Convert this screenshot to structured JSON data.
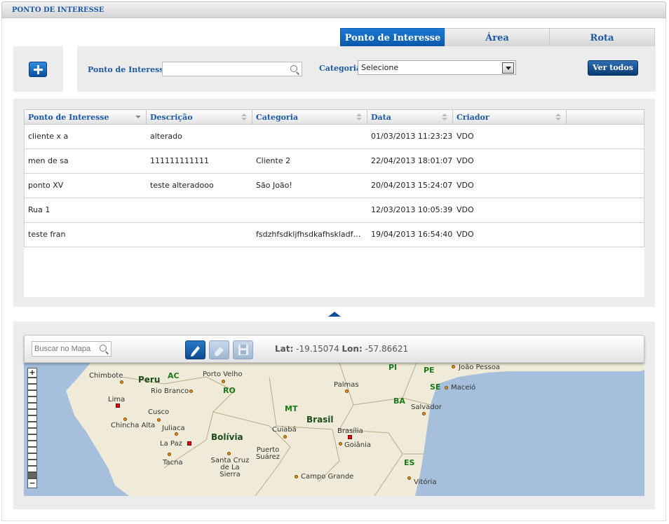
{
  "window": {
    "title": "PONTO DE INTERESSE"
  },
  "tabs": [
    {
      "label": "Ponto de Interesse",
      "active": true
    },
    {
      "label": "Área",
      "active": false
    },
    {
      "label": "Rota",
      "active": false
    }
  ],
  "filters": {
    "poi_label": "Ponto de Interesse:",
    "poi_value": "",
    "category_label": "Categoria:",
    "category_selected": "Selecione",
    "ver_todos": "Ver todos"
  },
  "grid": {
    "columns": [
      "Ponto de Interesse",
      "Descrição",
      "Categoria",
      "Data",
      "Criador"
    ],
    "rows": [
      [
        "cliente x a",
        "alterado",
        "",
        "01/03/2013 11:23:23",
        "VDO"
      ],
      [
        "men de sa",
        "111111111111",
        "Cliente 2",
        "22/04/2013 18:01:07",
        "VDO"
      ],
      [
        "ponto XV",
        "teste alteradooo",
        "São João!",
        "20/04/2013 15:24:07",
        "VDO"
      ],
      [
        "Rua 1",
        "",
        "",
        "12/03/2013 10:05:39",
        "VDO"
      ],
      [
        "teste fran",
        "",
        "fsdzhfsdkljfhsdkafhskladfhs...",
        "19/04/2013 16:54:40",
        "VDO"
      ]
    ]
  },
  "map": {
    "search_placeholder": "Buscar no Mapa",
    "lat_label": "Lat:",
    "lat_value": "-19.15074",
    "lon_label": "Lon:",
    "lon_value": "-57.86621",
    "zoom_in": "+",
    "zoom_out": "−",
    "places": {
      "chimbote": "Chimbote",
      "lima": "Lima",
      "chincha": "Chincha Alta",
      "cusco": "Cusco",
      "juliaca": "Juliaca",
      "lapaz": "La Paz",
      "tacna": "Tacna",
      "riobranco": "Rio Branco",
      "portovelho": "Porto Velho",
      "santacruz": "Santa Cruz de La Sierra",
      "puertosuarez": "Puerto Suárez",
      "cuiaba": "Cuiabá",
      "palmas": "Palmas",
      "brasilia": "Brasília",
      "goiania": "Goiânia",
      "campogrande": "Campo Grande",
      "salvador": "Salvador",
      "joaopessoa": "João Pessoa",
      "maceio": "Maceió",
      "vitoria": "Vitória"
    },
    "regions": {
      "ac": "AC",
      "ro": "RO",
      "mt": "MT",
      "pi": "PI",
      "pe": "PE",
      "se": "SE",
      "ba": "BA",
      "es": "ES"
    },
    "countries": {
      "peru": "Peru",
      "bolivia": "Bolívia",
      "brasil": "Brasil"
    }
  }
}
